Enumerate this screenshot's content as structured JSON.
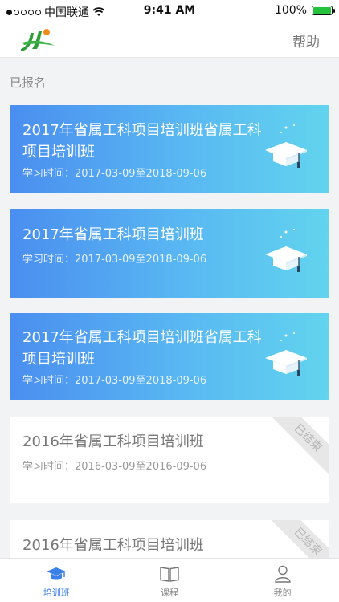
{
  "status_bar": {
    "carrier": "中国联通",
    "time": "9:41 AM",
    "battery": "100%"
  },
  "header": {
    "help_label": "帮助"
  },
  "section": {
    "title": "已报名"
  },
  "courses": [
    {
      "title": "2017年省属工科项目培训班省属工科项目培训班",
      "date": "学习时间：2017-03-09至2018-09-06",
      "status": "active"
    },
    {
      "title": "2017年省属工科项目培训班",
      "date": "学习时间：2017-03-09至2018-09-06",
      "status": "active"
    },
    {
      "title": "2017年省属工科项目培训班省属工科项目培训班",
      "date": "学习时间：2017-03-09至2018-09-06",
      "status": "active"
    },
    {
      "title": "2016年省属工科项目培训班",
      "date": "学习时间：2016-03-09至2016-09-06",
      "status": "ended",
      "badge": "已结束"
    },
    {
      "title": "2016年省属工科项目培训班",
      "date": "",
      "status": "ended",
      "badge": "已结束"
    }
  ],
  "tabs": [
    {
      "label": "培训班",
      "icon": "graduation-cap-icon",
      "active": true
    },
    {
      "label": "课程",
      "icon": "book-icon",
      "active": false
    },
    {
      "label": "我的",
      "icon": "user-icon",
      "active": false
    }
  ],
  "colors": {
    "accent": "#3b80e8",
    "card_gradient_start": "#4a8ef0",
    "card_gradient_end": "#62d4ee",
    "logo_green": "#2e9e3a",
    "logo_orange": "#f08c1e"
  }
}
